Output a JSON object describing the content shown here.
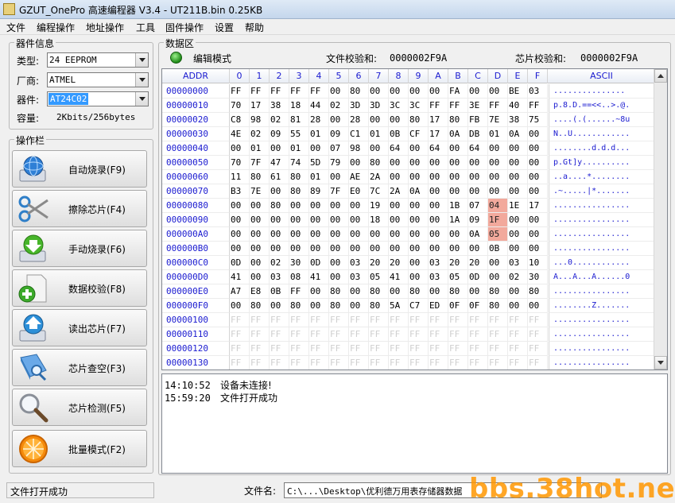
{
  "window": {
    "title": "GZUT_OnePro 高速编程器 V3.4 - UT211B.bin  0.25KB"
  },
  "menu": [
    "文件",
    "编程操作",
    "地址操作",
    "工具",
    "固件操作",
    "设置",
    "帮助"
  ],
  "device_info": {
    "group_title": "器件信息",
    "type_label": "类型:",
    "type_value": "24 EEPROM",
    "vendor_label": "厂商:",
    "vendor_value": "ATMEL",
    "device_label": "器件:",
    "device_value": "AT24C02",
    "capacity_label": "容量:",
    "capacity_value": "2Kbits/256bytes"
  },
  "operations": {
    "group_title": "操作栏",
    "buttons": [
      {
        "label": "自动烧录(F9)",
        "icon": "globe-burn-icon"
      },
      {
        "label": "擦除芯片(F4)",
        "icon": "scissors-icon"
      },
      {
        "label": "手动烧录(F6)",
        "icon": "download-arrow-icon"
      },
      {
        "label": "数据校验(F8)",
        "icon": "document-plus-icon"
      },
      {
        "label": "读出芯片(F7)",
        "icon": "upload-arrow-icon"
      },
      {
        "label": "芯片查空(F3)",
        "icon": "book-search-icon"
      },
      {
        "label": "芯片检测(F5)",
        "icon": "magnifier-icon"
      },
      {
        "label": "批量模式(F2)",
        "icon": "orange-slice-icon"
      }
    ]
  },
  "data_area": {
    "group_title": "数据区",
    "mode": "编辑模式",
    "file_checksum_label": "文件校验和:",
    "file_checksum": "0000002F9A",
    "chip_checksum_label": "芯片校验和:",
    "chip_checksum": "0000002F9A",
    "columns": [
      "ADDR",
      "0",
      "1",
      "2",
      "3",
      "4",
      "5",
      "6",
      "7",
      "8",
      "9",
      "A",
      "B",
      "C",
      "D",
      "E",
      "F",
      "ASCII"
    ],
    "rows": [
      {
        "addr": "00000000",
        "bytes": [
          "FF",
          "FF",
          "FF",
          "FF",
          "FF",
          "00",
          "80",
          "00",
          "00",
          "00",
          "00",
          "FA",
          "00",
          "00",
          "BE",
          "03"
        ],
        "ascii": "..............."
      },
      {
        "addr": "00000010",
        "bytes": [
          "70",
          "17",
          "38",
          "18",
          "44",
          "02",
          "3D",
          "3D",
          "3C",
          "3C",
          "FF",
          "FF",
          "3E",
          "FF",
          "40",
          "FF"
        ],
        "ascii": "p.8.D.==<<..>.@."
      },
      {
        "addr": "00000020",
        "bytes": [
          "C8",
          "98",
          "02",
          "81",
          "28",
          "00",
          "28",
          "00",
          "00",
          "80",
          "17",
          "80",
          "FB",
          "7E",
          "38",
          "75"
        ],
        "ascii": "....(.(......~8u"
      },
      {
        "addr": "00000030",
        "bytes": [
          "4E",
          "02",
          "09",
          "55",
          "01",
          "09",
          "C1",
          "01",
          "0B",
          "CF",
          "17",
          "0A",
          "DB",
          "01",
          "0A",
          "00"
        ],
        "ascii": "N..U............"
      },
      {
        "addr": "00000040",
        "bytes": [
          "00",
          "01",
          "00",
          "01",
          "00",
          "07",
          "98",
          "00",
          "64",
          "00",
          "64",
          "00",
          "64",
          "00",
          "00",
          "00"
        ],
        "ascii": "........d.d.d..."
      },
      {
        "addr": "00000050",
        "bytes": [
          "70",
          "7F",
          "47",
          "74",
          "5D",
          "79",
          "00",
          "80",
          "00",
          "00",
          "00",
          "00",
          "00",
          "00",
          "00",
          "00"
        ],
        "ascii": "p.Gt]y.........."
      },
      {
        "addr": "00000060",
        "bytes": [
          "11",
          "80",
          "61",
          "80",
          "01",
          "00",
          "AE",
          "2A",
          "00",
          "00",
          "00",
          "00",
          "00",
          "00",
          "00",
          "00"
        ],
        "ascii": "..a....*........"
      },
      {
        "addr": "00000070",
        "bytes": [
          "B3",
          "7E",
          "00",
          "80",
          "89",
          "7F",
          "E0",
          "7C",
          "2A",
          "0A",
          "00",
          "00",
          "00",
          "00",
          "00",
          "00"
        ],
        "ascii": ".~.....|*......."
      },
      {
        "addr": "00000080",
        "bytes": [
          "00",
          "00",
          "80",
          "00",
          "00",
          "00",
          "00",
          "19",
          "00",
          "00",
          "00",
          "1B",
          "07",
          "04",
          "1E",
          "17"
        ],
        "ascii": "................"
      },
      {
        "addr": "00000090",
        "bytes": [
          "00",
          "00",
          "00",
          "00",
          "00",
          "00",
          "00",
          "18",
          "00",
          "00",
          "00",
          "1A",
          "09",
          "1F",
          "00",
          "00"
        ],
        "ascii": "................"
      },
      {
        "addr": "000000A0",
        "bytes": [
          "00",
          "00",
          "00",
          "00",
          "00",
          "00",
          "00",
          "00",
          "00",
          "00",
          "00",
          "00",
          "0A",
          "05",
          "00",
          "00"
        ],
        "ascii": "................"
      },
      {
        "addr": "000000B0",
        "bytes": [
          "00",
          "00",
          "00",
          "00",
          "00",
          "00",
          "00",
          "00",
          "00",
          "00",
          "00",
          "00",
          "00",
          "0B",
          "00",
          "00"
        ],
        "ascii": "................"
      },
      {
        "addr": "000000C0",
        "bytes": [
          "0D",
          "00",
          "02",
          "30",
          "0D",
          "00",
          "03",
          "20",
          "20",
          "00",
          "03",
          "20",
          "20",
          "00",
          "03",
          "10"
        ],
        "ascii": "...0............"
      },
      {
        "addr": "000000D0",
        "bytes": [
          "41",
          "00",
          "03",
          "08",
          "41",
          "00",
          "03",
          "05",
          "41",
          "00",
          "03",
          "05",
          "0D",
          "00",
          "02",
          "30"
        ],
        "ascii": "A...A...A......0"
      },
      {
        "addr": "000000E0",
        "bytes": [
          "A7",
          "E8",
          "0B",
          "FF",
          "00",
          "80",
          "00",
          "80",
          "00",
          "80",
          "00",
          "80",
          "00",
          "80",
          "00",
          "80"
        ],
        "ascii": "................"
      },
      {
        "addr": "000000F0",
        "bytes": [
          "00",
          "80",
          "00",
          "80",
          "00",
          "80",
          "00",
          "80",
          "5A",
          "C7",
          "ED",
          "0F",
          "0F",
          "80",
          "00",
          "00"
        ],
        "ascii": "........Z......."
      },
      {
        "addr": "00000100",
        "bytes": [
          "FF",
          "FF",
          "FF",
          "FF",
          "FF",
          "FF",
          "FF",
          "FF",
          "FF",
          "FF",
          "FF",
          "FF",
          "FF",
          "FF",
          "FF",
          "FF"
        ],
        "ascii": "................",
        "empty": true
      },
      {
        "addr": "00000110",
        "bytes": [
          "FF",
          "FF",
          "FF",
          "FF",
          "FF",
          "FF",
          "FF",
          "FF",
          "FF",
          "FF",
          "FF",
          "FF",
          "FF",
          "FF",
          "FF",
          "FF"
        ],
        "ascii": "................",
        "empty": true
      },
      {
        "addr": "00000120",
        "bytes": [
          "FF",
          "FF",
          "FF",
          "FF",
          "FF",
          "FF",
          "FF",
          "FF",
          "FF",
          "FF",
          "FF",
          "FF",
          "FF",
          "FF",
          "FF",
          "FF"
        ],
        "ascii": "................",
        "empty": true
      },
      {
        "addr": "00000130",
        "bytes": [
          "FF",
          "FF",
          "FF",
          "FF",
          "FF",
          "FF",
          "FF",
          "FF",
          "FF",
          "FF",
          "FF",
          "FF",
          "FF",
          "FF",
          "FF",
          "FF"
        ],
        "ascii": "................",
        "empty": true
      }
    ],
    "highlighted": [
      {
        "row": 8,
        "col": 13
      },
      {
        "row": 9,
        "col": 13
      },
      {
        "row": 10,
        "col": 13
      }
    ],
    "highlight_color": "#f2a99c"
  },
  "log": [
    {
      "time": "14:10:52",
      "msg": "设备未连接!"
    },
    {
      "time": "15:59:20",
      "msg": "文件打开成功"
    }
  ],
  "status": {
    "left_text": "文件打开成功",
    "file_label": "文件名:",
    "file_path": "C:\\...\\Desktop\\优利德万用表存储器数据",
    "watermark": "bbs.38hot.net"
  }
}
